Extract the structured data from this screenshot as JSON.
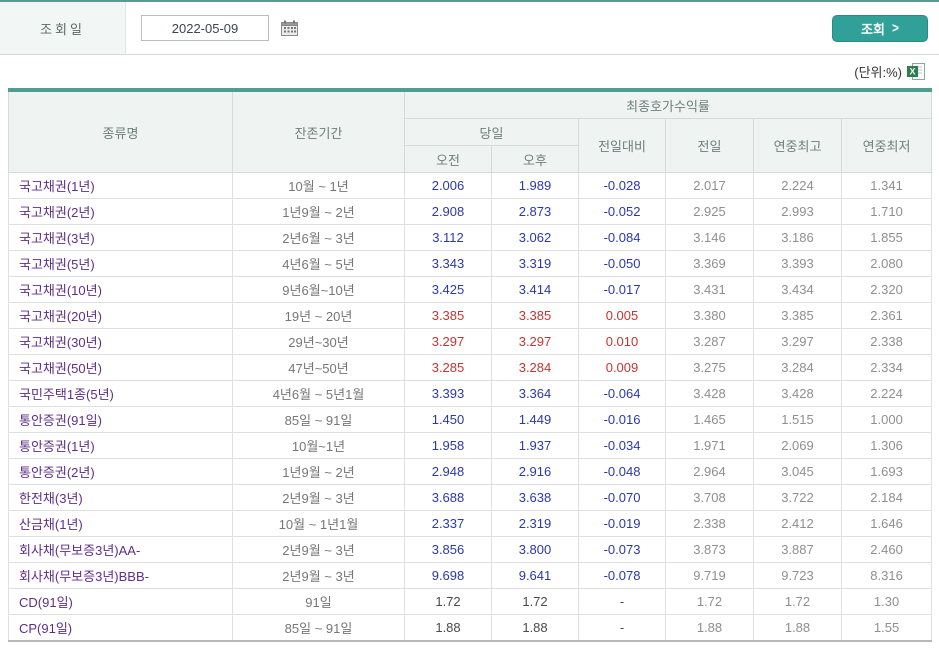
{
  "controls": {
    "date_label": "조회일",
    "date_value": "2022-05-09",
    "search_label": "조회",
    "search_arrow": ">",
    "calendar_icon": "calendar-icon",
    "excel_icon": "excel-download-icon"
  },
  "unit_note": "(단위:%)",
  "colors": {
    "accent_teal": "#31a098",
    "table_top_bar": "#4f9e92",
    "header_bg": "#eff4f2",
    "down_blue": "#2b39a8",
    "up_red": "#c23535",
    "name_purple": "#5f2e88",
    "muted_gray": "#8f8f8f"
  },
  "table": {
    "headers": {
      "name": "종류명",
      "period": "잔존기간",
      "group": "최종호가수익률",
      "today": "당일",
      "am": "오전",
      "pm": "오후",
      "change": "전일대비",
      "prev": "전일",
      "year_high": "연중최고",
      "year_low": "연중최저"
    },
    "rows": [
      {
        "name": "국고채권(1년)",
        "period": "10월 ~ 1년",
        "am": "2.006",
        "pm": "1.989",
        "change": "-0.028",
        "prev": "2.017",
        "high": "2.224",
        "low": "1.341",
        "trend": "down"
      },
      {
        "name": "국고채권(2년)",
        "period": "1년9월 ~ 2년",
        "am": "2.908",
        "pm": "2.873",
        "change": "-0.052",
        "prev": "2.925",
        "high": "2.993",
        "low": "1.710",
        "trend": "down"
      },
      {
        "name": "국고채권(3년)",
        "period": "2년6월 ~ 3년",
        "am": "3.112",
        "pm": "3.062",
        "change": "-0.084",
        "prev": "3.146",
        "high": "3.186",
        "low": "1.855",
        "trend": "down"
      },
      {
        "name": "국고채권(5년)",
        "period": "4년6월 ~ 5년",
        "am": "3.343",
        "pm": "3.319",
        "change": "-0.050",
        "prev": "3.369",
        "high": "3.393",
        "low": "2.080",
        "trend": "down"
      },
      {
        "name": "국고채권(10년)",
        "period": "9년6월~10년",
        "am": "3.425",
        "pm": "3.414",
        "change": "-0.017",
        "prev": "3.431",
        "high": "3.434",
        "low": "2.320",
        "trend": "down"
      },
      {
        "name": "국고채권(20년)",
        "period": "19년 ~ 20년",
        "am": "3.385",
        "pm": "3.385",
        "change": "0.005",
        "prev": "3.380",
        "high": "3.385",
        "low": "2.361",
        "trend": "up"
      },
      {
        "name": "국고채권(30년)",
        "period": "29년~30년",
        "am": "3.297",
        "pm": "3.297",
        "change": "0.010",
        "prev": "3.287",
        "high": "3.297",
        "low": "2.338",
        "trend": "up"
      },
      {
        "name": "국고채권(50년)",
        "period": "47년~50년",
        "am": "3.285",
        "pm": "3.284",
        "change": "0.009",
        "prev": "3.275",
        "high": "3.284",
        "low": "2.334",
        "trend": "up"
      },
      {
        "name": "국민주택1종(5년)",
        "period": "4년6월 ~ 5년1월",
        "am": "3.393",
        "pm": "3.364",
        "change": "-0.064",
        "prev": "3.428",
        "high": "3.428",
        "low": "2.224",
        "trend": "down"
      },
      {
        "name": "통안증권(91일)",
        "period": "85일 ~ 91일",
        "am": "1.450",
        "pm": "1.449",
        "change": "-0.016",
        "prev": "1.465",
        "high": "1.515",
        "low": "1.000",
        "trend": "down"
      },
      {
        "name": "통안증권(1년)",
        "period": "10월~1년",
        "am": "1.958",
        "pm": "1.937",
        "change": "-0.034",
        "prev": "1.971",
        "high": "2.069",
        "low": "1.306",
        "trend": "down"
      },
      {
        "name": "통안증권(2년)",
        "period": "1년9월 ~ 2년",
        "am": "2.948",
        "pm": "2.916",
        "change": "-0.048",
        "prev": "2.964",
        "high": "3.045",
        "low": "1.693",
        "trend": "down"
      },
      {
        "name": "한전채(3년)",
        "period": "2년9월 ~ 3년",
        "am": "3.688",
        "pm": "3.638",
        "change": "-0.070",
        "prev": "3.708",
        "high": "3.722",
        "low": "2.184",
        "trend": "down"
      },
      {
        "name": "산금채(1년)",
        "period": "10월 ~ 1년1월",
        "am": "2.337",
        "pm": "2.319",
        "change": "-0.019",
        "prev": "2.338",
        "high": "2.412",
        "low": "1.646",
        "trend": "down"
      },
      {
        "name": "회사채(무보증3년)AA-",
        "period": "2년9월 ~ 3년",
        "am": "3.856",
        "pm": "3.800",
        "change": "-0.073",
        "prev": "3.873",
        "high": "3.887",
        "low": "2.460",
        "trend": "down"
      },
      {
        "name": "회사채(무보증3년)BBB-",
        "period": "2년9월 ~ 3년",
        "am": "9.698",
        "pm": "9.641",
        "change": "-0.078",
        "prev": "9.719",
        "high": "9.723",
        "low": "8.316",
        "trend": "down"
      },
      {
        "name": "CD(91일)",
        "period": "91일",
        "am": "1.72",
        "pm": "1.72",
        "change": "-",
        "prev": "1.72",
        "high": "1.72",
        "low": "1.30",
        "trend": "flat"
      },
      {
        "name": "CP(91일)",
        "period": "85일 ~ 91일",
        "am": "1.88",
        "pm": "1.88",
        "change": "-",
        "prev": "1.88",
        "high": "1.88",
        "low": "1.55",
        "trend": "flat"
      }
    ]
  }
}
